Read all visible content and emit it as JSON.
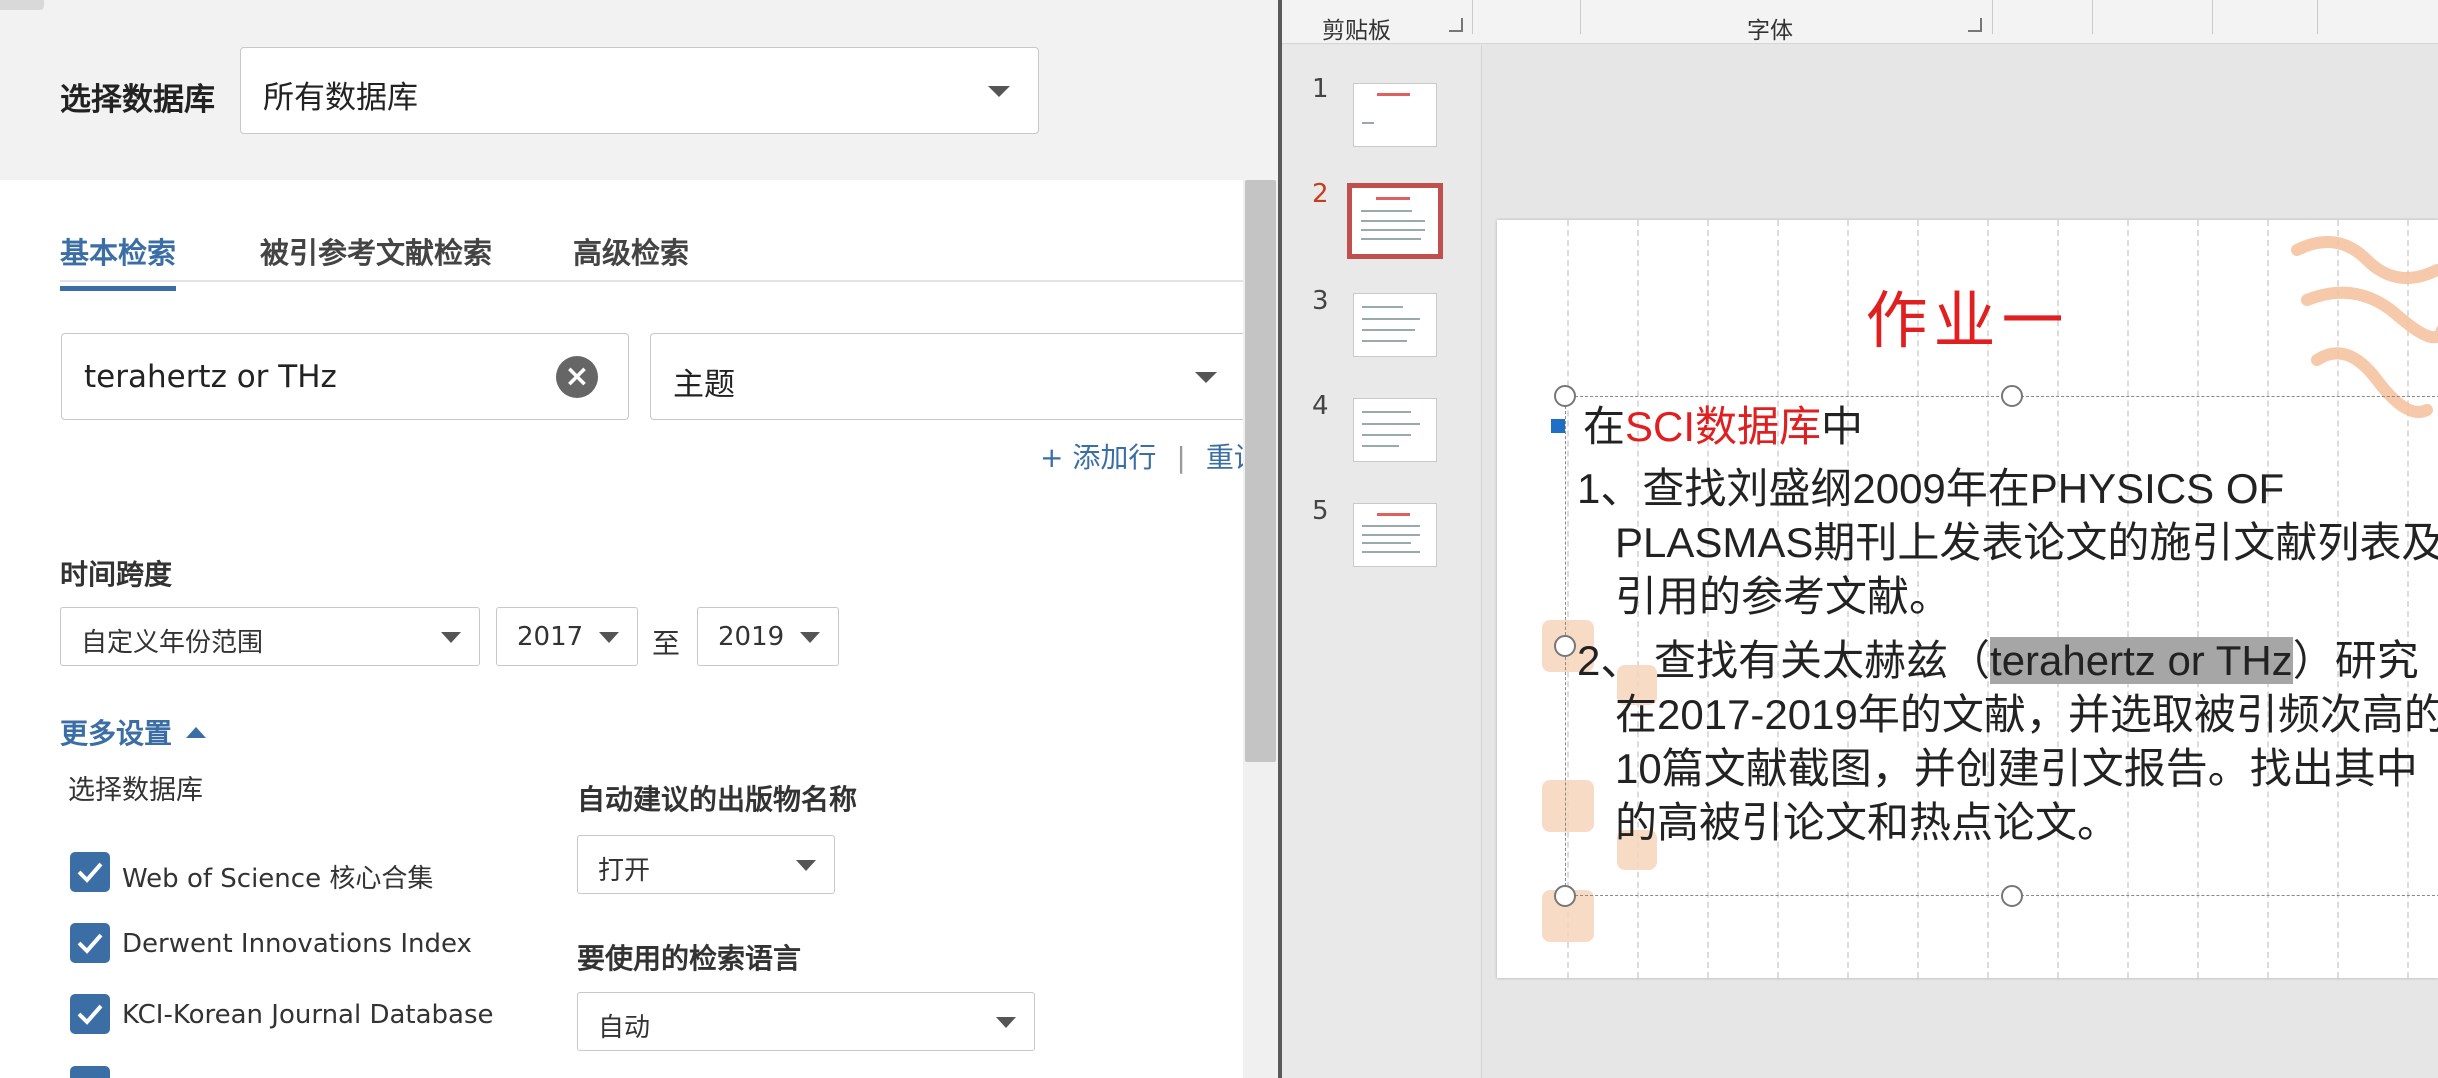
{
  "wos": {
    "db_label": "选择数据库",
    "db_value": "所有数据库",
    "tabs": [
      "基本检索",
      "被引参考文献检索",
      "高级检索"
    ],
    "query_value": "terahertz  or THz",
    "field_value": "主题",
    "add_row": "+ 添加行",
    "separator": "|",
    "reset": "重设",
    "timespan_label": "时间跨度",
    "range_value": "自定义年份范围",
    "from_year": "2017",
    "to_label": "至",
    "to_year": "2019",
    "more_settings": "更多设置",
    "sub_db_label": "选择数据库",
    "databases": [
      {
        "label": "Web of Science 核心合集",
        "checked": true
      },
      {
        "label": "Derwent Innovations Index",
        "checked": true
      },
      {
        "label": "KCI-Korean Journal Database",
        "checked": true
      }
    ],
    "pub_label": "自动建议的出版物名称",
    "pub_value": "打开",
    "lang_label": "要使用的检索语言",
    "lang_value": "自动"
  },
  "ppt": {
    "ribbon_groups": [
      "剪贴板",
      "字体"
    ],
    "slide_numbers": [
      "1",
      "2",
      "3",
      "4",
      "5"
    ],
    "active_slide": "2",
    "slide": {
      "title": "作业一",
      "bullet_pre": "在",
      "bullet_red": "SCI数据库",
      "bullet_post": "中",
      "item1": "1、查找刘盛纲2009年在PHYSICS OF PLASMAS期刊上发表论文的施引文献列表及引用的参考文献。",
      "item2_pre": "2、 查找有关太赫兹（",
      "item2_hl": "terahertz  or THz",
      "item2_post": "）研究在2017-2019年的文献，并选取被引频次高的10篇文献截图，并创建引文报告。找出其中的高被引论文和热点论文。"
    }
  },
  "colors": {
    "link_blue": "#3b6ea5",
    "title_red": "#e02020",
    "active_slide_border": "#c0504d"
  }
}
